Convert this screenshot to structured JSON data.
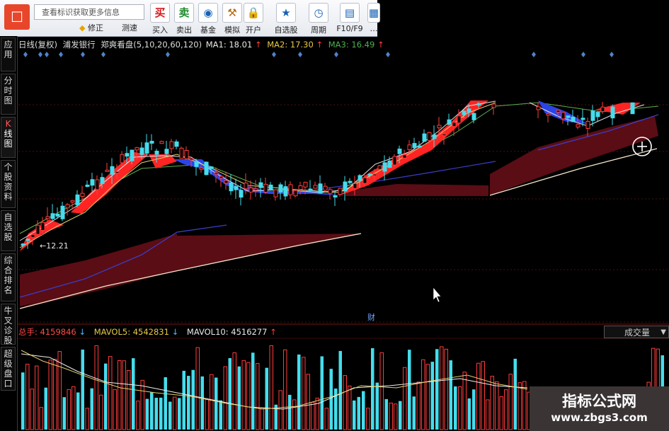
{
  "toolbar": {
    "search_placeholder": "查看标识获取更多信息",
    "small_buttons": [
      "修正",
      "测速"
    ],
    "buttons": [
      {
        "label": "买入",
        "icon_char": "买",
        "icon_color": "#d4171d",
        "icon": "buy-icon"
      },
      {
        "label": "卖出",
        "icon_char": "卖",
        "icon_color": "#1b8a2a",
        "icon": "sell-icon"
      },
      {
        "label": "基金",
        "icon_char": "◉",
        "icon_color": "#1561b5",
        "icon": "fund-icon"
      },
      {
        "label": "模拟",
        "icon_char": "⚒",
        "icon_color": "#b46a12",
        "icon": "hammer-icon"
      },
      {
        "label": "开户",
        "icon_char": "🔒",
        "icon_color": "#c08a12",
        "icon": "lock-icon"
      },
      {
        "label": "自选股",
        "icon_char": "★",
        "icon_color": "#1561b5",
        "icon": "star-icon"
      },
      {
        "label": "周期",
        "icon_char": "◷",
        "icon_color": "#1561b5",
        "icon": "clock-icon"
      },
      {
        "label": "F10/F9",
        "icon_char": "▤",
        "icon_color": "#1561b5",
        "icon": "f10-icon"
      },
      {
        "label": "…",
        "icon_char": "▦",
        "icon_color": "#1561b5",
        "icon": "more-icon"
      }
    ]
  },
  "side_tabs": [
    {
      "label": "应用"
    },
    {
      "label": "分时图"
    },
    {
      "label": "K线图",
      "active": true
    },
    {
      "label": "个股资料"
    },
    {
      "label": "自选股"
    },
    {
      "label": "综合排名"
    },
    {
      "label": "牛叉诊股"
    },
    {
      "label": "超级盘口"
    }
  ],
  "title_bar": {
    "period": "日线(复权)",
    "stock": "浦发银行",
    "indicator": "郑爽看盘(5,10,20,60,120)",
    "ma1": "MA1: 18.01",
    "ma2": "MA2: 17.30",
    "ma3": "MA3: 16.49"
  },
  "annotations": {
    "low_label": "←12.21",
    "cai_label": "财"
  },
  "volume": {
    "total": "总手: 4159846",
    "mavol5": "MAVOL5: 4542831",
    "mavol10": "MAVOL10: 4516277",
    "select_label": "成交量"
  },
  "watermark": {
    "line1": "指标公式网",
    "line2": "www.zbgs3.com"
  },
  "colors": {
    "up": "#ff3b3b",
    "down": "#45dcec",
    "ma_white": "#e6e6e6",
    "ma_yellow": "#e0d070",
    "ma_green": "#5fb04f",
    "ma_blue": "#3c3cc8",
    "band": "#5a0d14"
  }
}
